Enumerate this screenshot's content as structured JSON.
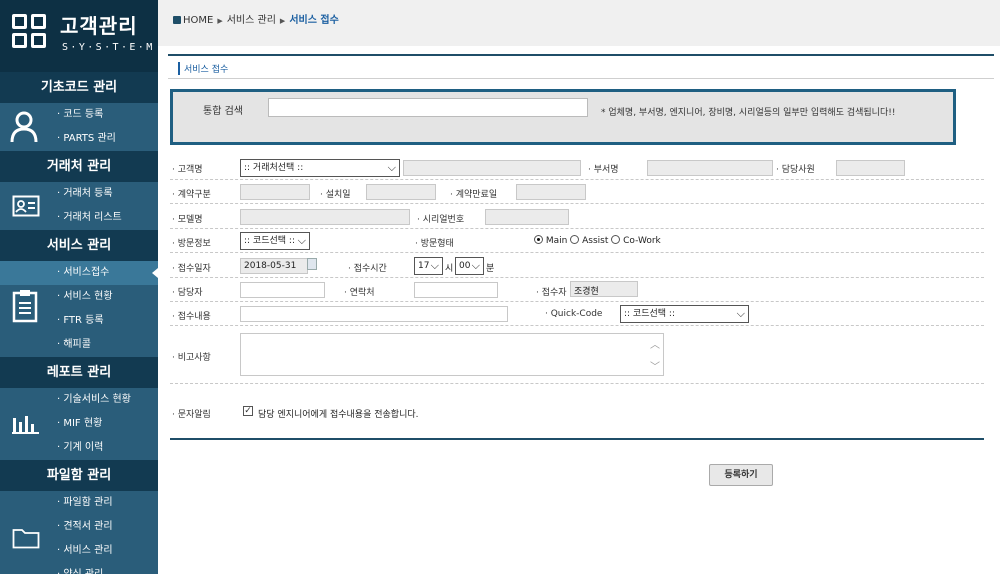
{
  "logo": {
    "title": "고객관리",
    "subtitle": "S·Y·S·T·E·M"
  },
  "sidebar": {
    "sections": [
      {
        "title": "기초코드 관리",
        "icon": "user-icon",
        "items": [
          "· 코드 등록",
          "· PARTS 관리"
        ]
      },
      {
        "title": "거래처 관리",
        "icon": "contact-card-icon",
        "items": [
          "· 거래처 등록",
          "· 거래처 리스트"
        ]
      },
      {
        "title": "서비스 관리",
        "icon": "clipboard-icon",
        "items": [
          "· 서비스접수",
          "· 서비스 현황",
          "· FTR 등록",
          "· 해피콜"
        ],
        "active_index": 0
      },
      {
        "title": "레포트 관리",
        "icon": "bar-chart-icon",
        "items": [
          "· 기술서비스 현황",
          "· MIF 현황",
          "· 기계 이력"
        ]
      },
      {
        "title": "파일함 관리",
        "icon": "folder-icon",
        "items": [
          "· 파일함 관리",
          "· 견적서 관리",
          "· 서비스 관리",
          "· 양식 관리"
        ]
      }
    ]
  },
  "breadcrumb": {
    "home": "HOME",
    "level1": "서비스 관리",
    "current": "서비스 접수"
  },
  "panel": {
    "title": "서비스 접수"
  },
  "search": {
    "label": "통합 검색",
    "value": "",
    "hint": "* 업체명, 부서명, 엔지니어, 장비명, 시리얼등의 일부만 입력해도 검색됩니다!!"
  },
  "form": {
    "customer_label": "· 고객명",
    "customer_select": ":: 거래처선택 ::",
    "dept_label": "· 부서명",
    "manager_label": "· 담당사원",
    "contract_type_label": "· 계약구분",
    "install_date_label": "· 설치일",
    "contract_end_label": "· 계약만료일",
    "model_label": "· 모델명",
    "serial_label": "· 시리얼번호",
    "visit_info_label": "· 방문정보",
    "visit_info_select": ":: 코드선택 ::",
    "visit_type_label": "· 방문형태",
    "visit_options": [
      "Main",
      "Assist",
      "Co-Work"
    ],
    "visit_selected": "Main",
    "receipt_date_label": "· 접수일자",
    "receipt_date_value": "2018-05-31",
    "receipt_time_label": "· 접수시간",
    "hour_value": "17",
    "hour_unit": "시",
    "minute_value": "00",
    "minute_unit": "분",
    "person_label": "· 담당자",
    "contact_label": "· 연락처",
    "receiver_label": "· 접수자",
    "receiver_value": "조경현",
    "content_label": "· 접수내용",
    "quickcode_label": "· Quick-Code",
    "quickcode_select": ":: 코드선택 ::",
    "remarks_label": "· 비고사항",
    "sms_label": "· 문자알림",
    "sms_checked": true,
    "sms_text": "담당 엔지니어에게 접수내용을 전송합니다."
  },
  "buttons": {
    "submit": "등록하기"
  }
}
